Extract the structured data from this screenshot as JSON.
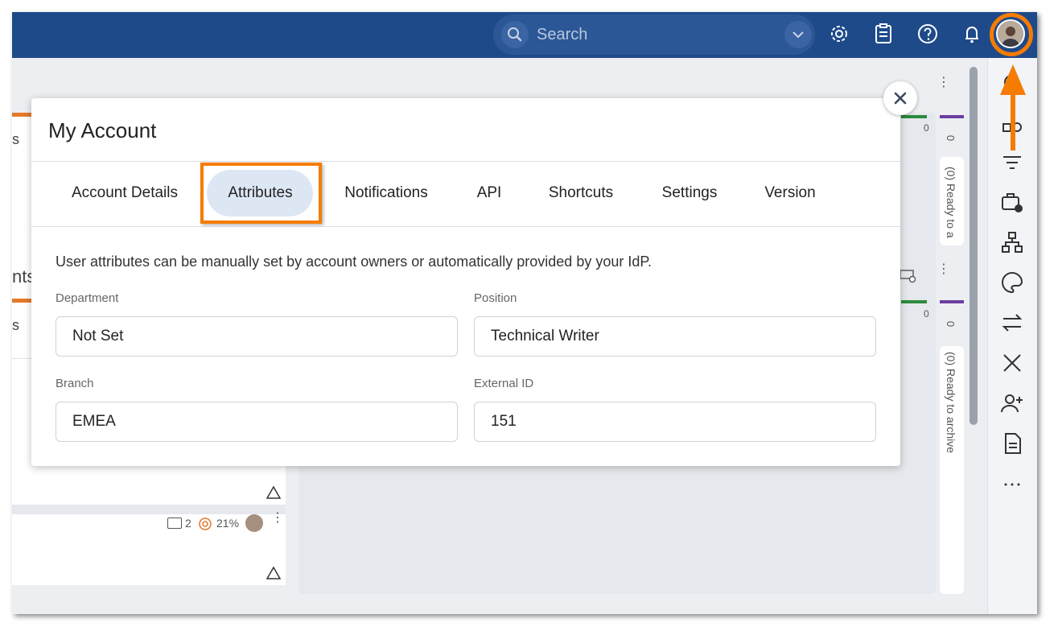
{
  "topbar": {
    "search_placeholder": "Search",
    "icons": [
      "search-icon",
      "chevron-down-icon",
      "gear-icon",
      "clipboard-icon",
      "help-icon",
      "bell-icon",
      "avatar"
    ]
  },
  "background": {
    "left_fragments": [
      "s",
      "nts",
      "s"
    ],
    "card_comments": "2",
    "card_progress": "21%",
    "col_counts": [
      "0",
      "0",
      "0",
      "0"
    ],
    "col_labels": [
      "(0) Ready to a",
      "(0) Ready to archive"
    ]
  },
  "modal": {
    "title": "My Account",
    "tabs": [
      {
        "label": "Account Details"
      },
      {
        "label": "Attributes"
      },
      {
        "label": "Notifications"
      },
      {
        "label": "API"
      },
      {
        "label": "Shortcuts"
      },
      {
        "label": "Settings"
      },
      {
        "label": "Version"
      }
    ],
    "active_tab": "Attributes",
    "description": "User attributes can be manually set by account owners or automatically provided by your IdP.",
    "fields": {
      "department": {
        "label": "Department",
        "value": "Not Set"
      },
      "position": {
        "label": "Position",
        "value": "Technical Writer"
      },
      "branch": {
        "label": "Branch",
        "value": "EMEA"
      },
      "external_id": {
        "label": "External ID",
        "value": "151"
      }
    }
  },
  "colors": {
    "topbar": "#1e4a8a",
    "highlight": "#f57c00",
    "active_tab_bg": "#dde7f4"
  }
}
